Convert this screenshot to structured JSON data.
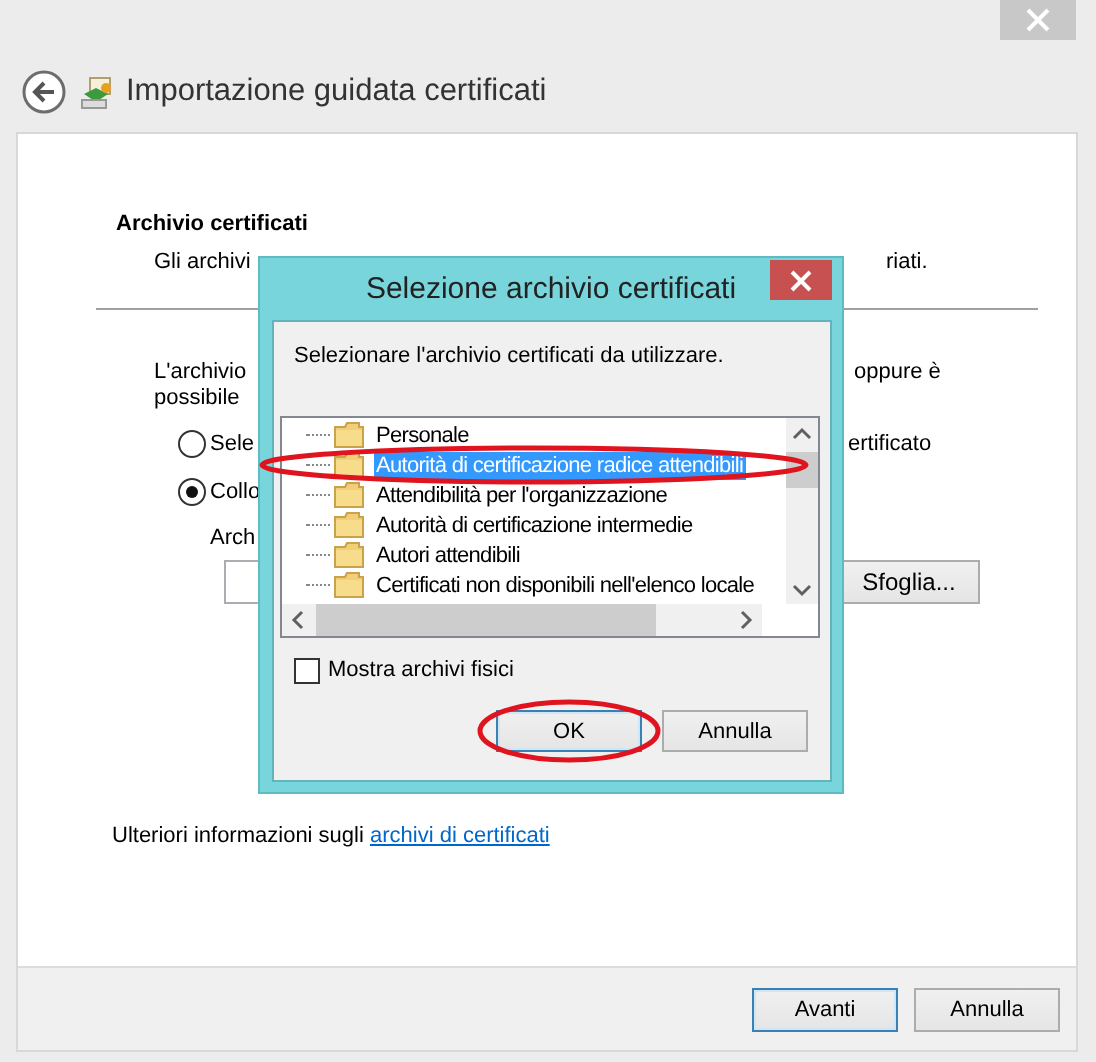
{
  "window": {
    "title": "Importazione guidata certificati"
  },
  "page": {
    "heading": "Archivio certificati",
    "description": [
      "Gli archivi",
      "riati."
    ],
    "info": [
      {
        "left": "L'archivio",
        "right": "oppure è"
      },
      {
        "left": "possibile"
      }
    ],
    "options": [
      {
        "left": "Sele",
        "right": "ertificato",
        "selected": false
      },
      {
        "left": "Collo",
        "selected": true
      }
    ],
    "field_label": "Arch",
    "browse_button": "Sfoglia...",
    "more_info": "Ulteriori informazioni sugli",
    "more_info_link": "archivi di certificati"
  },
  "buttons": [
    {
      "label": "Avanti",
      "default": true
    },
    {
      "label": "Annulla",
      "default": false
    }
  ],
  "dialog": {
    "title": "Selezione archivio certificati",
    "prompt": "Selezionare l'archivio certificati da utilizzare.",
    "stores": [
      {
        "label": "Personale",
        "selected": false,
        "circled": false
      },
      {
        "label": "Autorità di certificazione radice attendibili",
        "selected": true,
        "circled": true
      },
      {
        "label": "Attendibilità per l'organizzazione",
        "selected": false,
        "circled": false
      },
      {
        "label": "Autorità di certificazione intermedie",
        "selected": false,
        "circled": false
      },
      {
        "label": "Autori attendibili",
        "selected": false,
        "circled": false
      },
      {
        "label": "Certificati non disponibili nell'elenco locale",
        "selected": false,
        "circled": false
      }
    ],
    "show_physical": {
      "label": "Mostra archivi fisici",
      "checked": false
    },
    "buttons": [
      {
        "label": "OK",
        "default": true,
        "circled": true
      },
      {
        "label": "Annulla",
        "default": false,
        "circled": false
      }
    ]
  }
}
